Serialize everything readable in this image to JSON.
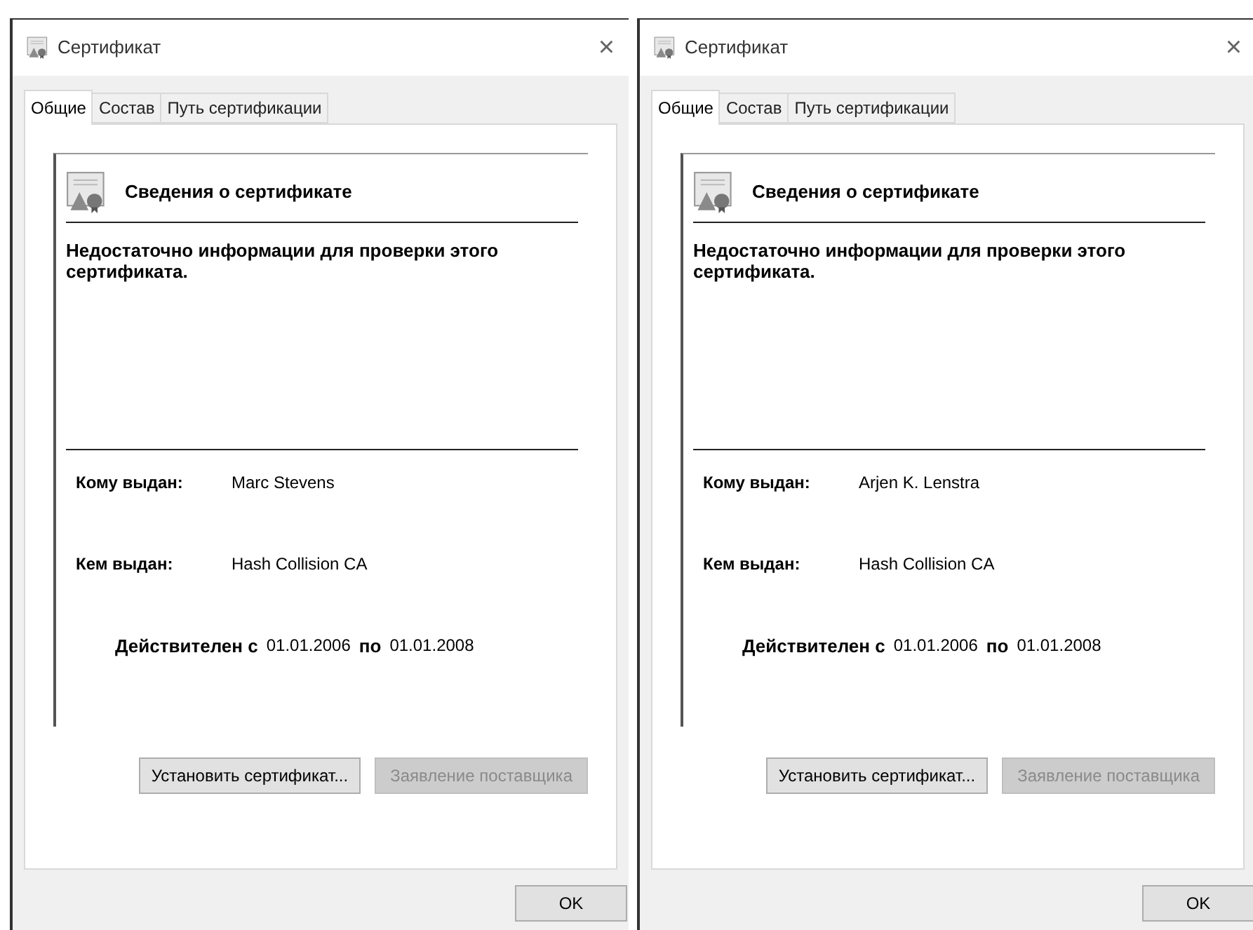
{
  "windows": [
    {
      "title": "Сертификат",
      "close": "×",
      "tabs": [
        {
          "label": "Общие",
          "selected": true
        },
        {
          "label": "Состав",
          "selected": false
        },
        {
          "label": "Путь сертификации",
          "selected": false
        }
      ],
      "header": "Сведения о сертификате",
      "message": "Недостаточно информации для проверки этого сертификата.",
      "issued_to": {
        "label": "Кому выдан:",
        "value": "Marc Stevens"
      },
      "issued_by": {
        "label": "Кем выдан:",
        "value": "Hash Collision CA"
      },
      "validity": {
        "from_label": "Действителен с",
        "from": "01.01.2006",
        "to_label": "по",
        "to": "01.01.2008"
      },
      "buttons": [
        {
          "label": "Установить сертификат...",
          "disabled": false
        },
        {
          "label": "Заявление поставщика",
          "disabled": true
        }
      ],
      "ok": "OK"
    },
    {
      "title": "Сертификат",
      "close": "×",
      "tabs": [
        {
          "label": "Общие",
          "selected": true
        },
        {
          "label": "Состав",
          "selected": false
        },
        {
          "label": "Путь сертификации",
          "selected": false
        }
      ],
      "header": "Сведения о сертификате",
      "message": "Недостаточно информации для проверки этого сертификата.",
      "issued_to": {
        "label": "Кому выдан:",
        "value": "Arjen K. Lenstra"
      },
      "issued_by": {
        "label": "Кем выдан:",
        "value": "Hash Collision CA"
      },
      "validity": {
        "from_label": "Действителен с",
        "from": "01.01.2006",
        "to_label": "по",
        "to": "01.01.2008"
      },
      "buttons": [
        {
          "label": "Установить сертификат...",
          "disabled": false
        },
        {
          "label": "Заявление поставщика",
          "disabled": true
        }
      ],
      "ok": "OK"
    }
  ]
}
